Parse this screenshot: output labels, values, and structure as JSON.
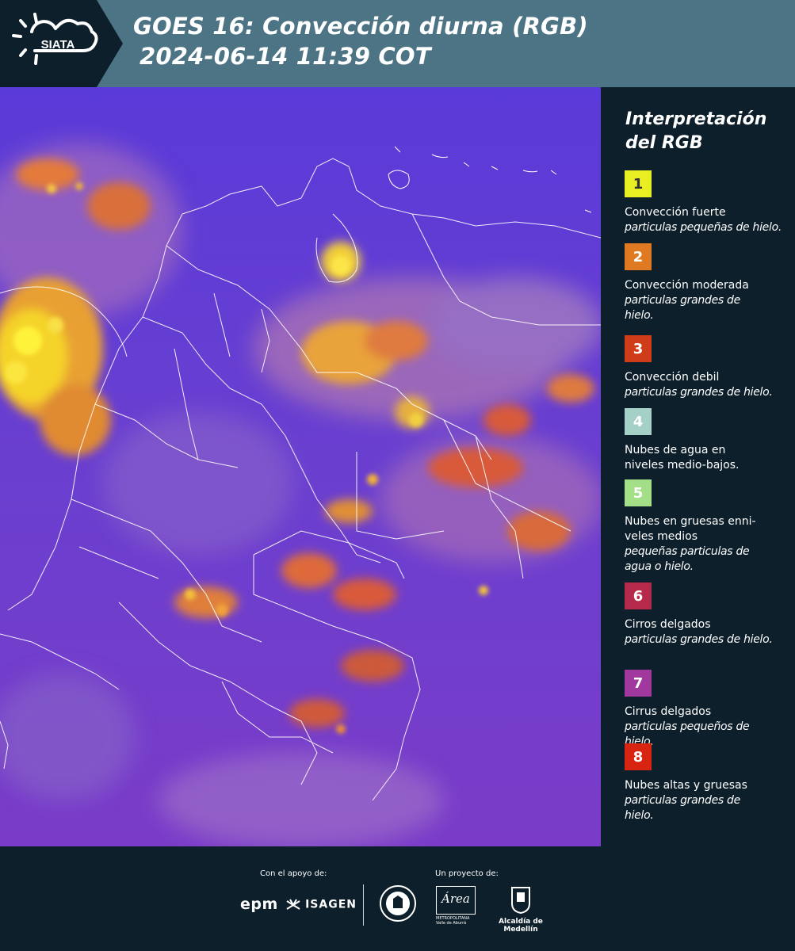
{
  "header": {
    "logo_text": "SIATA",
    "title_line1": "GOES 16: Convección diurna (RGB)",
    "title_line2": "2024-06-14 11:39 COT",
    "background_color": "#4c7484"
  },
  "legend": {
    "title_line1": "Interpretación",
    "title_line2": "del RGB",
    "items": [
      {
        "number": "1",
        "color": "#e8ee22",
        "text_lines": [
          "Convección fuerte"
        ],
        "sub_lines": [
          "particulas pequeñas de hielo."
        ]
      },
      {
        "number": "2",
        "color": "#e07a22",
        "text_lines": [
          "Convección moderada"
        ],
        "sub_lines": [
          "particulas grandes de",
          "hielo."
        ]
      },
      {
        "number": "3",
        "color": "#cf3d18",
        "text_lines": [
          "Convección debil"
        ],
        "sub_lines": [
          "particulas grandes de hielo."
        ]
      },
      {
        "number": "4",
        "color": "#a4d0c7",
        "text_lines": [
          "Nubes de agua en",
          "niveles medio-bajos."
        ],
        "sub_lines": []
      },
      {
        "number": "5",
        "color": "#a2df87",
        "text_lines": [
          "Nubes en gruesas enni-",
          "veles medios"
        ],
        "sub_lines": [
          "pequeñas particulas de",
          "agua o hielo."
        ]
      },
      {
        "number": "6",
        "color": "#b52a4b",
        "text_lines": [
          "Cirros delgados"
        ],
        "sub_lines": [
          "particulas grandes de hielo."
        ]
      },
      {
        "number": "7",
        "color": "#a0389d",
        "text_lines": [
          "Cirrus delgados"
        ],
        "sub_lines": [
          "particulas pequeños de",
          "hielo."
        ]
      },
      {
        "number": "8",
        "color": "#d72512",
        "text_lines": [
          "Nubes altas y gruesas"
        ],
        "sub_lines": [
          "particulas grandes de",
          "hielo."
        ]
      }
    ]
  },
  "footer": {
    "support_label": "Con el apoyo de:",
    "project_label": "Un proyecto de:",
    "sponsor_1": "epm",
    "sponsor_2": "ISAGEN",
    "partner_area": "Área",
    "partner_area_sub": "METROPOLITANA",
    "partner_area_sub2": "Valle de Aburrá",
    "partner_alcaldia": "Alcaldía de Medellín"
  }
}
